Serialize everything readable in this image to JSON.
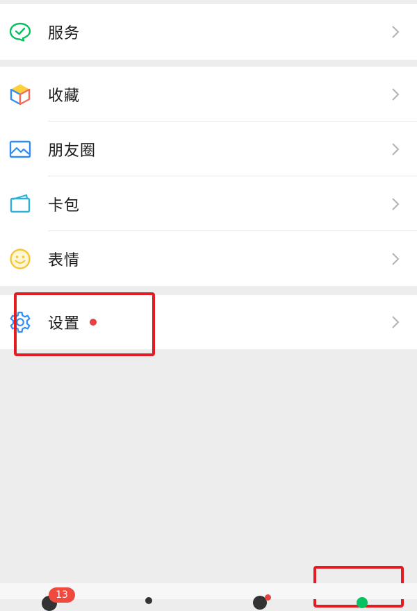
{
  "colors": {
    "accent_green": "#07c160",
    "red_highlight": "#e31b23",
    "red_dot": "#e64340",
    "badge_red": "#f04a3e"
  },
  "menu": {
    "services": {
      "label": "服务",
      "icon": "wechat-pay-icon"
    },
    "group2": [
      {
        "label": "收藏",
        "icon": "favorites-cube-icon"
      },
      {
        "label": "朋友圈",
        "icon": "moments-picture-icon"
      },
      {
        "label": "卡包",
        "icon": "card-wallet-icon"
      },
      {
        "label": "表情",
        "icon": "smiley-icon"
      }
    ],
    "settings": {
      "label": "设置",
      "icon": "gear-icon",
      "has_red_dot": true
    }
  },
  "tabbar": {
    "chats_badge": "13"
  }
}
